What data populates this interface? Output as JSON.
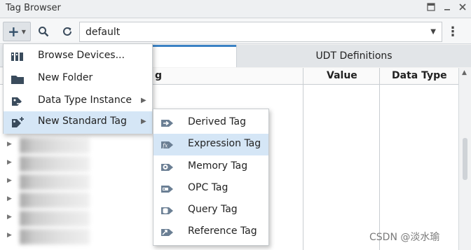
{
  "window": {
    "title": "Tag Browser"
  },
  "toolbar": {
    "provider_value": "default"
  },
  "tabs": {
    "tag_tab_partial": "g",
    "udt": "UDT Definitions"
  },
  "table": {
    "col_value": "Value",
    "col_datatype": "Data Type"
  },
  "menu": {
    "items": [
      {
        "label": "Browse Devices...",
        "icon": "browse-devices-icon"
      },
      {
        "label": "New Folder",
        "icon": "folder-icon"
      },
      {
        "label": "Data Type Instance",
        "icon": "data-type-instance-icon",
        "has_submenu": true
      },
      {
        "label": "New Standard Tag",
        "icon": "new-standard-tag-icon",
        "has_submenu": true,
        "highlighted": true
      }
    ]
  },
  "submenu": {
    "items": [
      {
        "label": "Derived Tag",
        "icon": "derived-tag-icon"
      },
      {
        "label": "Expression Tag",
        "icon": "expression-tag-icon",
        "highlighted": true
      },
      {
        "label": "Memory Tag",
        "icon": "memory-tag-icon"
      },
      {
        "label": "OPC Tag",
        "icon": "opc-tag-icon"
      },
      {
        "label": "Query Tag",
        "icon": "query-tag-icon"
      },
      {
        "label": "Reference Tag",
        "icon": "reference-tag-icon"
      }
    ]
  },
  "colors": {
    "highlight": "#d5e6f6",
    "tab_accent": "#3b82c4",
    "icon_blue": "#6b7f94"
  },
  "watermark": "CSDN @淡水瑜"
}
